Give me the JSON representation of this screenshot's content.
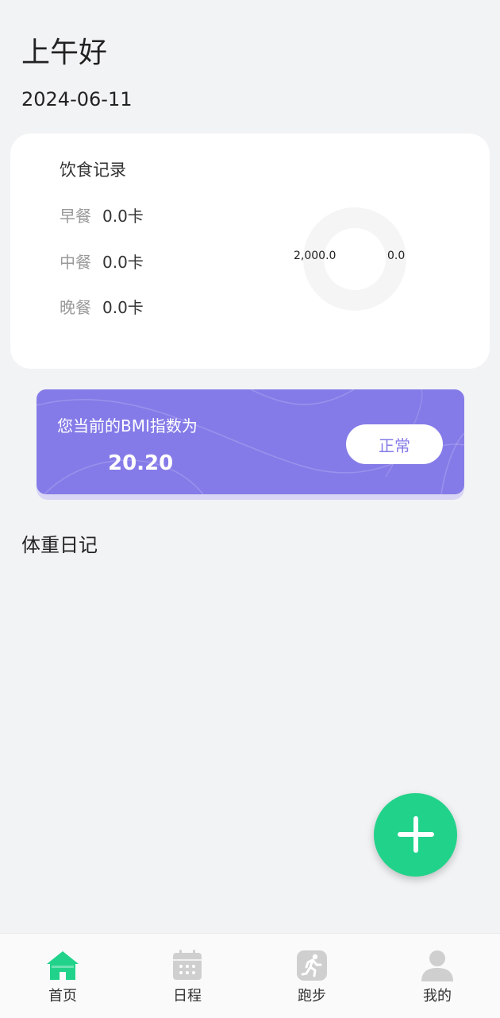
{
  "header": {
    "greeting": "上午好",
    "date": "2024-06-11"
  },
  "diet": {
    "title": "饮食记录",
    "meals": [
      {
        "label": "早餐",
        "value": "0.0卡"
      },
      {
        "label": "中餐",
        "value": "0.0卡"
      },
      {
        "label": "晚餐",
        "value": "0.0卡"
      }
    ],
    "ring_left": "2,000.0",
    "ring_right": "0.0",
    "ring_progress": 0
  },
  "bmi": {
    "label": "您当前的BMI指数为",
    "value": "20.20",
    "status": "正常"
  },
  "weight_diary": {
    "title": "体重日记"
  },
  "fab": {
    "icon": "plus-icon"
  },
  "tabbar": {
    "items": [
      {
        "label": "首页",
        "icon": "home-icon",
        "active": true
      },
      {
        "label": "日程",
        "icon": "calendar-icon",
        "active": false
      },
      {
        "label": "跑步",
        "icon": "running-icon",
        "active": false
      },
      {
        "label": "我的",
        "icon": "user-icon",
        "active": false
      }
    ]
  },
  "colors": {
    "accent": "#21d38a",
    "bmi_card": "#857be8",
    "background": "#f2f3f5",
    "inactive_icon": "#cfcfcf"
  }
}
